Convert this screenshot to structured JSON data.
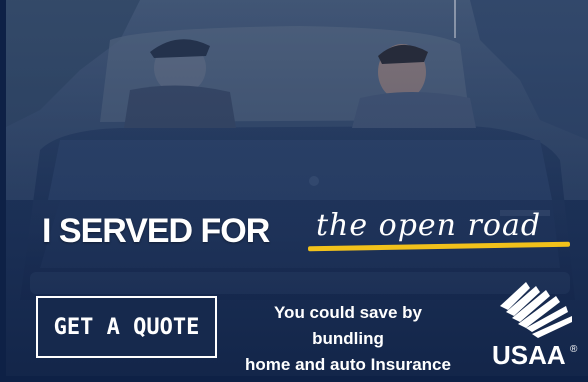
{
  "ad": {
    "headline": "I SERVED FOR",
    "headline_script": "the open road",
    "cta_label": "GET A QUOTE",
    "tagline_line1": "You could save by bundling",
    "tagline_line2": "home and auto Insurance",
    "brand_name": "USAA",
    "brand_mark": "®"
  },
  "colors": {
    "navy": "#16294d",
    "accent_yellow": "#f2c21b",
    "text": "#ffffff"
  },
  "icons": {
    "logo": "usaa-eagle-icon"
  }
}
